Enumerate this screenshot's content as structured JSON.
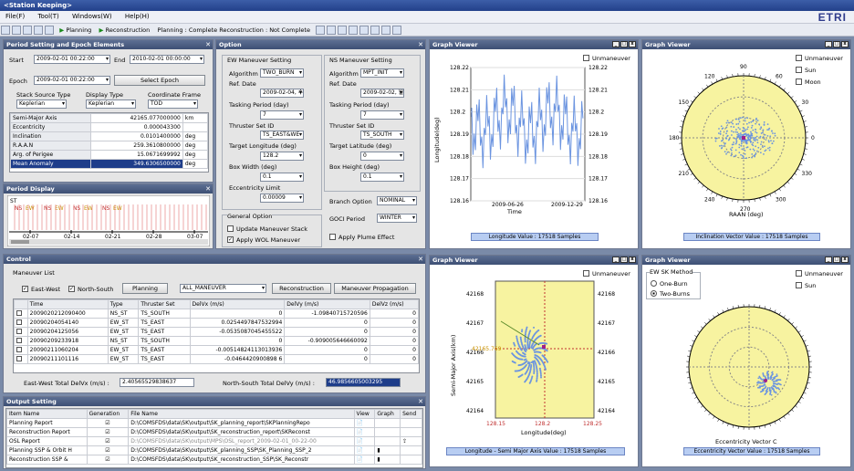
{
  "app_title": "<Station Keeping>",
  "logo": "ETRI",
  "menu": [
    "File(F)",
    "Tool(T)",
    "Windows(W)",
    "Help(H)"
  ],
  "toolbar": {
    "planning": "Planning",
    "reconstruction": "Reconstruction",
    "status": "Planning : Complete  Reconstruction : Not Complete"
  },
  "period": {
    "title": "Period Setting and Epoch Elements",
    "start_label": "Start",
    "start": "2009-02-01 00:22:00",
    "end_label": "End",
    "end": "2010-02-01 00:00:00",
    "epoch_label": "Epoch",
    "epoch": "2009-02-01 00:22:00",
    "select_epoch": "Select Epoch",
    "stack_label": "Stack Source Type",
    "stack": "Keplerian",
    "display_label": "Display Type",
    "display": "Keplerian",
    "frame_label": "Coordinate Frame",
    "frame": "TOD",
    "rows": [
      [
        "Semi-Major Axis",
        "42165.077000000",
        "km"
      ],
      [
        "Eccentricity",
        "0.000043300",
        ""
      ],
      [
        "Inclination",
        "0.0101400000",
        "deg"
      ],
      [
        "R.A.A.N",
        "259.3610800000",
        "deg"
      ],
      [
        "Arg. of Perigee",
        "15.0671699992",
        "deg"
      ],
      [
        "Mean Anomaly",
        "349.6306500000",
        "deg"
      ]
    ]
  },
  "period_display": {
    "title": "Period Display",
    "st": "ST",
    "ticks": [
      "02-07",
      "02-14",
      "02-21",
      "02-28",
      "03-07"
    ]
  },
  "option": {
    "title": "Option",
    "ew_title": "EW Maneuver Setting",
    "ns_title": "NS Maneuver Setting",
    "algorithm_label": "Algorithm",
    "ew_algorithm": "TWO_BURN",
    "ns_algorithm": "MPT_INIT",
    "ref_date_label": "Ref. Date",
    "ew_ref_date": "2009-02-04, 수",
    "ns_ref_date": "2009-02-02, 월",
    "tasking_label": "Tasking Period (day)",
    "ew_tasking": "7",
    "ns_tasking": "7",
    "thruster_label": "Thruster Set ID",
    "ew_thruster": "TS_EAST&WE",
    "ns_thruster": "TS_SOUTH",
    "target_lon_label": "Target Longitude (deg)",
    "target_lon": "128.2",
    "target_lat_label": "Target Latitude (deg)",
    "target_lat": "0",
    "box_width_label": "Box Width (deg)",
    "box_width": "0.1",
    "box_height_label": "Box Height (deg)",
    "box_height": "0.1",
    "ecc_limit_label": "Eccentricity Limit",
    "ecc_limit": "0.00009",
    "general_title": "General Option",
    "update_stack": "Update Maneuver Stack",
    "apply_wol": "Apply WOL Maneuver",
    "branch_label": "Branch Option",
    "branch": "NOMINAL",
    "goci_label": "GOCI Period",
    "goci": "WINTER",
    "apply_plume": "Apply Plume Effect"
  },
  "control": {
    "title": "Control",
    "list_title": "Maneuver List",
    "east_west": "East-West",
    "north_south": "North-South",
    "planning_btn": "Planning",
    "filter": "ALL_MANEUVER",
    "reconstruction_btn": "Reconstruction",
    "propagation_btn": "Maneuver Propagation",
    "columns": [
      "Time",
      "Type",
      "Thruster Set",
      "DelVx (m/s)",
      "DelVy (m/s)",
      "DelVz (m/s)"
    ],
    "rows": [
      [
        "2009020212090400",
        "NS_ST",
        "TS_SOUTH",
        "0",
        "-1.09840715720596",
        "0"
      ],
      [
        "20090204054140",
        "EW_ST",
        "TS_EAST",
        "0.0254497847532994",
        "0",
        "0"
      ],
      [
        "20090204125056",
        "EW_ST",
        "TS_EAST",
        "-0.0535087045455522",
        "0",
        "0"
      ],
      [
        "20090209233918",
        "NS_ST",
        "TS_SOUTH",
        "0",
        "-0.909005646660092",
        "0"
      ],
      [
        "20090211060204",
        "EW_ST",
        "TS_EAST",
        "-0.00514824113013936",
        "0",
        "0"
      ],
      [
        "20090211101116",
        "EW_ST",
        "TS_EAST",
        "-0.0464420900898 6",
        "0",
        "0"
      ]
    ],
    "ew_total_label": "East-West Total DelVx (m/s) :",
    "ew_total": "2.40565529838637",
    "ns_total_label": "North-South Total DelVy (m/s) :",
    "ns_total": "46.9856605003295"
  },
  "output": {
    "title": "Output Setting",
    "columns": [
      "Item Name",
      "Generation",
      "File Name",
      "View",
      "Graph",
      "Send"
    ],
    "rows": [
      [
        "Planning Report",
        "D:\\COMSFDS\\data\\SK\\output\\SK_planning_report\\SKPlanningRepo"
      ],
      [
        "Reconstruction Report",
        "D:\\COMSFDS\\data\\SK\\output\\SK_reconstruction_report\\SKReconst"
      ],
      [
        "OSL Report",
        "D:\\COMSFDS\\data\\SK\\output\\MPS\\OSL_report_2009-02-01_00-22-00"
      ],
      [
        "Planning SSP & Orbit H",
        "D:\\COMSFDS\\data\\SK\\output\\SK_planning_SSP\\SK_Planning_SSP_2"
      ],
      [
        "Reconstruction SSP &",
        "D:\\COMSFDS\\data\\SK\\output\\SK_reconstruction_SSP\\SK_Reconstr"
      ]
    ]
  },
  "graphs": {
    "title": "Graph Viewer",
    "unmaneuver": "Unmaneuver",
    "sun": "Sun",
    "moon": "Moon",
    "g1": {
      "ylabel": "Longitude(deg)",
      "xlabel": "Time",
      "yticks": [
        "128.22",
        "128.21",
        "128.2",
        "128.19",
        "128.18",
        "128.17",
        "128.16"
      ],
      "xticks": [
        "2009-06-26",
        "2009-12-29"
      ],
      "legend": "Longitude Value : 17518 Samples"
    },
    "g2": {
      "xlabel": "RAAN (deg)",
      "legend": "Inclination Vector Value : 17518 Samples",
      "angles": [
        "0",
        "30",
        "60",
        "90",
        "120",
        "150",
        "180",
        "210",
        "240",
        "270",
        "300",
        "330"
      ]
    },
    "g3": {
      "ylabel": "Semi-Major Axis(km)",
      "xlabel": "Longitude(deg)",
      "yticks": [
        "42168",
        "42167",
        "42166",
        "42165",
        "42164"
      ],
      "xticks": [
        "128.15",
        "128.2",
        "128.25"
      ],
      "marker": "42165.769",
      "legend": "Longitude - Semi Major Axis Value : 17518 Samples"
    },
    "g4": {
      "method_title": "EW SK Method",
      "one_burn": "One-Burn",
      "two_burns": "Two-Burns",
      "xlabel": "Eccentricity Vector C",
      "legend": "Eccentricity Vector Value : 17518 Samples"
    }
  },
  "colors": {
    "data": "#6b94e0",
    "yellow": "#f7f3a0",
    "title": "#3d4f74"
  }
}
